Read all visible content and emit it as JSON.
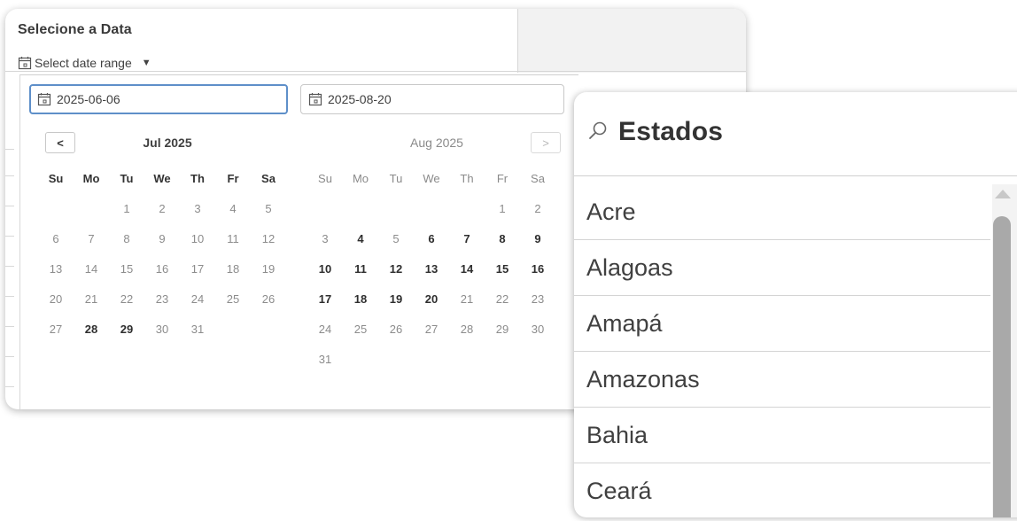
{
  "filter": {
    "title": "Selecione a Data",
    "range_label": "Select date range",
    "caret": "▼"
  },
  "inputs": {
    "start": "2025-06-06",
    "end": "2025-08-20"
  },
  "calendar": {
    "prev_label": "<",
    "next_label": ">",
    "weekdays": [
      "Su",
      "Mo",
      "Tu",
      "We",
      "Th",
      "Fr",
      "Sa"
    ],
    "left": {
      "title": "Jul 2025",
      "days": [
        "",
        "",
        "1",
        "2",
        "3",
        "4",
        "5",
        "6",
        "7",
        "8",
        "9",
        "10",
        "11",
        "12",
        "13",
        "14",
        "15",
        "16",
        "17",
        "18",
        "19",
        "20",
        "21",
        "22",
        "23",
        "24",
        "25",
        "26",
        "27",
        "28",
        "29",
        "30",
        "31",
        "",
        ""
      ],
      "bold_days": [
        "28",
        "29"
      ]
    },
    "right": {
      "title": "Aug 2025",
      "days": [
        "",
        "",
        "",
        "",
        "",
        "1",
        "2",
        "3",
        "4",
        "5",
        "6",
        "7",
        "8",
        "9",
        "10",
        "11",
        "12",
        "13",
        "14",
        "15",
        "16",
        "17",
        "18",
        "19",
        "20",
        "21",
        "22",
        "23",
        "24",
        "25",
        "26",
        "27",
        "28",
        "29",
        "30",
        "31",
        "",
        "",
        "",
        "",
        "",
        ""
      ],
      "bold_days": [
        "4",
        "6",
        "7",
        "8",
        "9",
        "10",
        "11",
        "12",
        "13",
        "14",
        "15",
        "16",
        "17",
        "18",
        "19",
        "20"
      ]
    }
  },
  "estados": {
    "title": "Estados",
    "items": [
      "Acre",
      "Alagoas",
      "Amapá",
      "Amazonas",
      "Bahia",
      "Ceará"
    ]
  },
  "colors": {
    "active_border": "#5e8fc9",
    "muted_day": "#8c8c8c",
    "bold_day": "#2e2e2e"
  }
}
